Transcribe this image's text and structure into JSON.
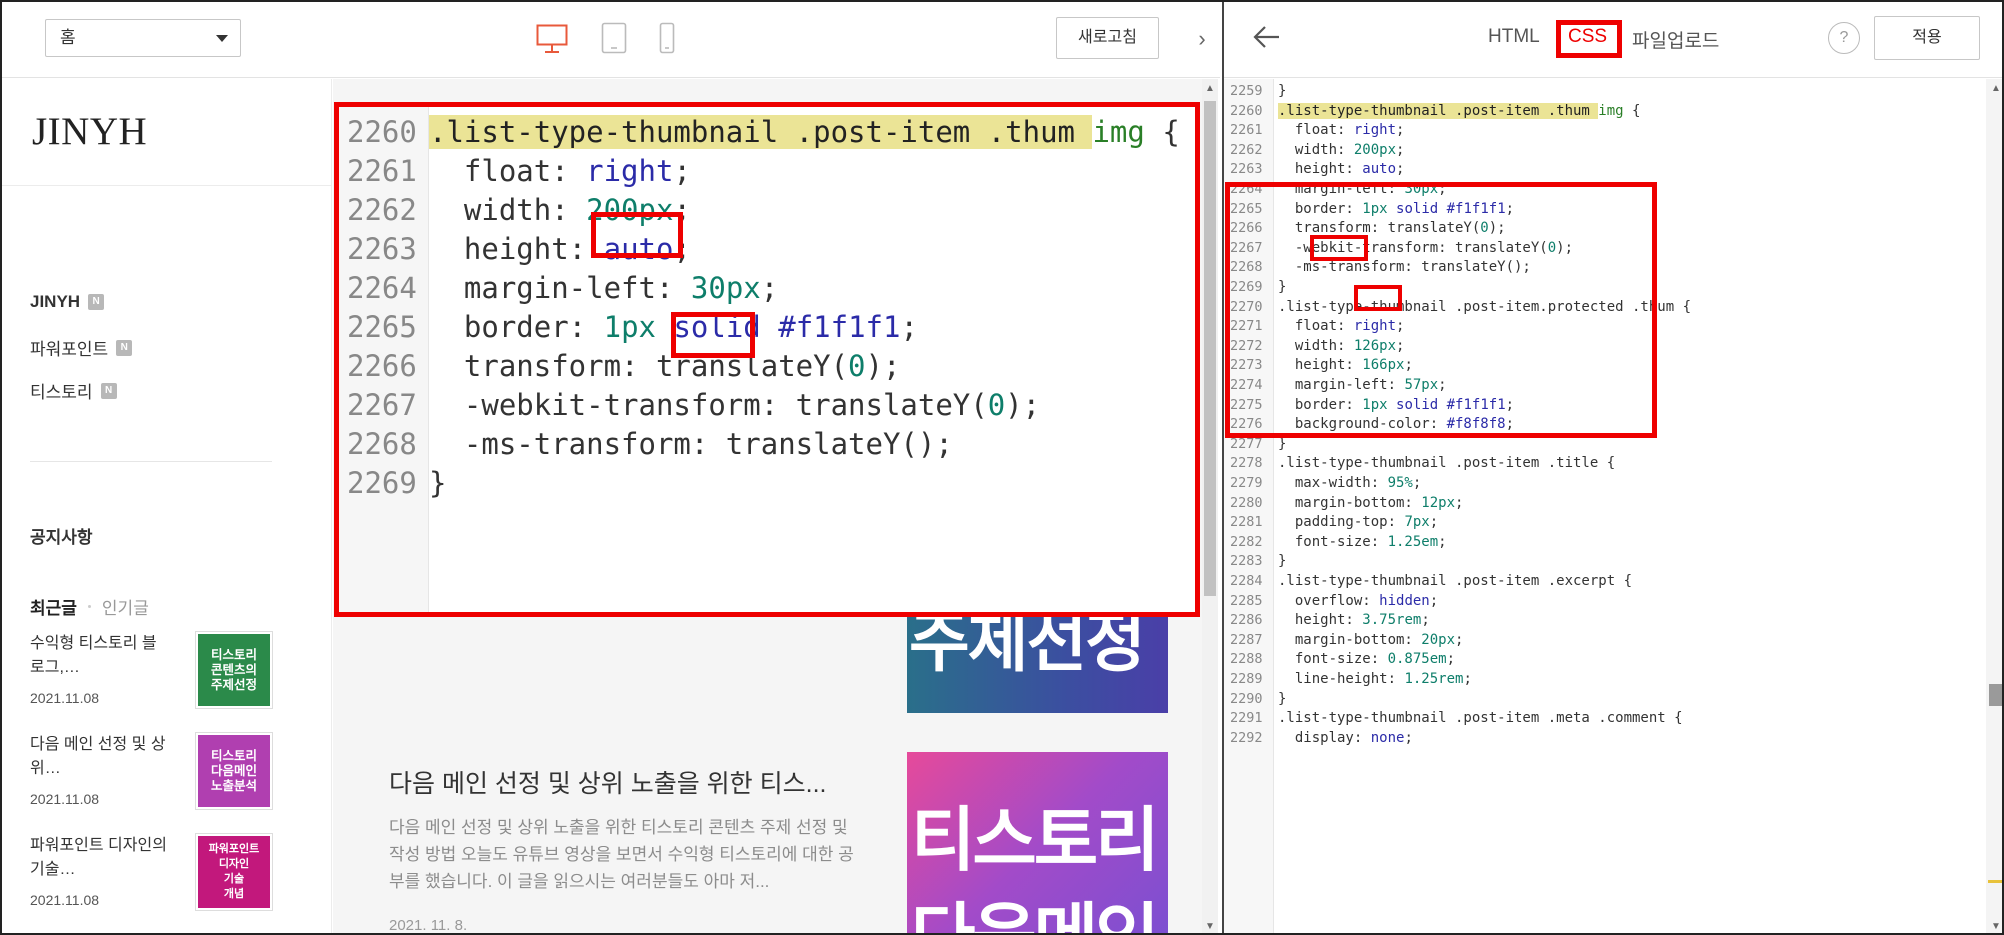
{
  "toolbar": {
    "page_select": "홈",
    "refresh_label": "새로고침"
  },
  "blog": {
    "logo": "JINYH",
    "categories": [
      {
        "label": "JINYH",
        "badge": "N"
      },
      {
        "label": "파워포인트",
        "badge": "N"
      },
      {
        "label": "티스토리",
        "badge": "N"
      }
    ],
    "notice": "공지사항",
    "tab_recent": "최근글",
    "tab_popular": "인기글",
    "recent_posts": [
      {
        "title": "수익형 티스토리 블로그,…",
        "date": "2021.11.08",
        "thumb": [
          "티스토리",
          "콘텐츠의",
          "주제선정"
        ],
        "thumb_color": "#2b8a4a"
      },
      {
        "title": "다음 메인 선정 및 상위…",
        "date": "2021.11.08",
        "thumb": [
          "티스토리",
          "다음메인",
          "노출분석"
        ],
        "thumb_color": "#b03fb0"
      },
      {
        "title": "파워포인트 디자인의 기술…",
        "date": "2021.11.08",
        "thumb": [
          "파워포인트",
          "디자인",
          "기술",
          "개념"
        ],
        "thumb_color": "#c2187c"
      }
    ],
    "big_image_1": "주제선정",
    "big_image_2_line1": "티스토리",
    "big_image_2_line2": "다음메인",
    "article_title": "다음 메인 선정 및 상위 노출을 위한 티스...",
    "article_excerpt": "다음 메인 선정 및 상위 노출을 위한 티스토리 콘텐츠 주제 선정 및 작성 방법 오늘도 유튜브 영상을 보면서 수익형 티스토리에 대한 공부를 했습니다. 이 글을 읽으시는 여러분들도 아마 저...",
    "article_date": "2021. 11. 8."
  },
  "zoom": {
    "lines": [
      {
        "num": "2260",
        "parts": [
          [
            "sel",
            ".list-type-thumbnail .post-item .thum "
          ],
          [
            "tag",
            "img"
          ],
          [
            "p",
            " {"
          ]
        ],
        "highlight": true
      },
      {
        "num": "2261",
        "parts": [
          [
            "p",
            "  float: "
          ],
          [
            "val",
            "right"
          ],
          [
            "p",
            ";"
          ]
        ]
      },
      {
        "num": "2262",
        "parts": [
          [
            "p",
            "  width: "
          ],
          [
            "num",
            "200px"
          ],
          [
            "p",
            ";"
          ]
        ]
      },
      {
        "num": "2263",
        "parts": [
          [
            "p",
            "  height: "
          ],
          [
            "val",
            "auto"
          ],
          [
            "p",
            ";"
          ]
        ]
      },
      {
        "num": "2264",
        "parts": [
          [
            "p",
            "  margin-left: "
          ],
          [
            "num",
            "30px"
          ],
          [
            "p",
            ";"
          ]
        ]
      },
      {
        "num": "2265",
        "parts": [
          [
            "p",
            "  border: "
          ],
          [
            "num",
            "1px"
          ],
          [
            "p",
            " "
          ],
          [
            "val",
            "solid"
          ],
          [
            "p",
            " "
          ],
          [
            "val",
            "#f1f1f1"
          ],
          [
            "p",
            ";"
          ]
        ]
      },
      {
        "num": "2266",
        "parts": [
          [
            "p",
            "  transform: translateY("
          ],
          [
            "num",
            "0"
          ],
          [
            "p",
            ");"
          ]
        ]
      },
      {
        "num": "2267",
        "parts": [
          [
            "p",
            "  -webkit-transform: translateY("
          ],
          [
            "num",
            "0"
          ],
          [
            "p",
            ");"
          ]
        ]
      },
      {
        "num": "2268",
        "parts": [
          [
            "p",
            "  -ms-transform: translateY();"
          ]
        ]
      },
      {
        "num": "2269",
        "parts": [
          [
            "p",
            "}"
          ]
        ]
      }
    ]
  },
  "editor_tabs": {
    "html": "HTML",
    "css": "CSS",
    "upload": "파일업로드",
    "help": "?",
    "apply": "적용"
  },
  "editor": {
    "lines": [
      {
        "num": "2259",
        "parts": [
          [
            "p",
            "}"
          ]
        ]
      },
      {
        "num": "2260",
        "parts": [
          [
            "sel",
            ".list-type-thumbnail .post-item .thum "
          ],
          [
            "tag",
            "img"
          ],
          [
            "p",
            " {"
          ]
        ],
        "highlight": true
      },
      {
        "num": "2261",
        "parts": [
          [
            "p",
            "  float: "
          ],
          [
            "val",
            "right"
          ],
          [
            "p",
            ";"
          ]
        ]
      },
      {
        "num": "2262",
        "parts": [
          [
            "p",
            "  width: "
          ],
          [
            "num",
            "200px"
          ],
          [
            "p",
            ";"
          ]
        ]
      },
      {
        "num": "2263",
        "parts": [
          [
            "p",
            "  height: "
          ],
          [
            "val",
            "auto"
          ],
          [
            "p",
            ";"
          ]
        ]
      },
      {
        "num": "2264",
        "parts": [
          [
            "p",
            "  margin-left: "
          ],
          [
            "num",
            "30px"
          ],
          [
            "p",
            ";"
          ]
        ]
      },
      {
        "num": "2265",
        "parts": [
          [
            "p",
            "  border: "
          ],
          [
            "num",
            "1px"
          ],
          [
            "p",
            " "
          ],
          [
            "val",
            "solid"
          ],
          [
            "p",
            " "
          ],
          [
            "val",
            "#f1f1f1"
          ],
          [
            "p",
            ";"
          ]
        ]
      },
      {
        "num": "2266",
        "parts": [
          [
            "p",
            "  transform: translateY("
          ],
          [
            "num",
            "0"
          ],
          [
            "p",
            ");"
          ]
        ]
      },
      {
        "num": "2267",
        "parts": [
          [
            "p",
            "  -webkit-transform: translateY("
          ],
          [
            "num",
            "0"
          ],
          [
            "p",
            ");"
          ]
        ]
      },
      {
        "num": "2268",
        "parts": [
          [
            "p",
            "  -ms-transform: translateY();"
          ]
        ]
      },
      {
        "num": "2269",
        "parts": [
          [
            "p",
            "}"
          ]
        ]
      },
      {
        "num": "2270",
        "parts": [
          [
            "p",
            ".list-type-thumbnail .post-item.protected .thum {"
          ]
        ]
      },
      {
        "num": "2271",
        "parts": [
          [
            "p",
            "  float: "
          ],
          [
            "val",
            "right"
          ],
          [
            "p",
            ";"
          ]
        ]
      },
      {
        "num": "2272",
        "parts": [
          [
            "p",
            "  width: "
          ],
          [
            "num",
            "126px"
          ],
          [
            "p",
            ";"
          ]
        ]
      },
      {
        "num": "2273",
        "parts": [
          [
            "p",
            "  height: "
          ],
          [
            "num",
            "166px"
          ],
          [
            "p",
            ";"
          ]
        ]
      },
      {
        "num": "2274",
        "parts": [
          [
            "p",
            "  margin-left: "
          ],
          [
            "num",
            "57px"
          ],
          [
            "p",
            ";"
          ]
        ]
      },
      {
        "num": "2275",
        "parts": [
          [
            "p",
            "  border: "
          ],
          [
            "num",
            "1px"
          ],
          [
            "p",
            " "
          ],
          [
            "val",
            "solid"
          ],
          [
            "p",
            " "
          ],
          [
            "val",
            "#f1f1f1"
          ],
          [
            "p",
            ";"
          ]
        ]
      },
      {
        "num": "2276",
        "parts": [
          [
            "p",
            "  background-color: "
          ],
          [
            "val",
            "#f8f8f8"
          ],
          [
            "p",
            ";"
          ]
        ]
      },
      {
        "num": "2277",
        "parts": [
          [
            "p",
            "}"
          ]
        ]
      },
      {
        "num": "2278",
        "parts": [
          [
            "p",
            ".list-type-thumbnail .post-item .title {"
          ]
        ]
      },
      {
        "num": "2279",
        "parts": [
          [
            "p",
            "  max-width: "
          ],
          [
            "num",
            "95%"
          ],
          [
            "p",
            ";"
          ]
        ]
      },
      {
        "num": "2280",
        "parts": [
          [
            "p",
            "  margin-bottom: "
          ],
          [
            "num",
            "12px"
          ],
          [
            "p",
            ";"
          ]
        ]
      },
      {
        "num": "2281",
        "parts": [
          [
            "p",
            "  padding-top: "
          ],
          [
            "num",
            "7px"
          ],
          [
            "p",
            ";"
          ]
        ]
      },
      {
        "num": "2282",
        "parts": [
          [
            "p",
            "  font-size: "
          ],
          [
            "num",
            "1.25em"
          ],
          [
            "p",
            ";"
          ]
        ]
      },
      {
        "num": "2283",
        "parts": [
          [
            "p",
            "}"
          ]
        ]
      },
      {
        "num": "2284",
        "parts": [
          [
            "p",
            ".list-type-thumbnail .post-item .excerpt {"
          ]
        ]
      },
      {
        "num": "2285",
        "parts": [
          [
            "p",
            "  overflow: "
          ],
          [
            "val",
            "hidden"
          ],
          [
            "p",
            ";"
          ]
        ]
      },
      {
        "num": "2286",
        "parts": [
          [
            "p",
            "  height: "
          ],
          [
            "num",
            "3.75rem"
          ],
          [
            "p",
            ";"
          ]
        ]
      },
      {
        "num": "2287",
        "parts": [
          [
            "p",
            "  margin-bottom: "
          ],
          [
            "num",
            "20px"
          ],
          [
            "p",
            ";"
          ]
        ]
      },
      {
        "num": "2288",
        "parts": [
          [
            "p",
            "  font-size: "
          ],
          [
            "num",
            "0.875em"
          ],
          [
            "p",
            ";"
          ]
        ]
      },
      {
        "num": "2289",
        "parts": [
          [
            "p",
            "  line-height: "
          ],
          [
            "num",
            "1.25rem"
          ],
          [
            "p",
            ";"
          ]
        ]
      },
      {
        "num": "2290",
        "parts": [
          [
            "p",
            "}"
          ]
        ]
      },
      {
        "num": "2291",
        "parts": [
          [
            "p",
            ".list-type-thumbnail .post-item .meta .comment {"
          ]
        ]
      },
      {
        "num": "2292",
        "parts": [
          [
            "p",
            "  display: "
          ],
          [
            "val",
            "none"
          ],
          [
            "p",
            ";"
          ]
        ]
      }
    ]
  },
  "colors": {
    "highlight_box": "#e00000",
    "selector_highlight": "#ebe496",
    "number": "#0e7e6a",
    "keyword": "#2b2ba8",
    "tag": "#2a7f27"
  }
}
